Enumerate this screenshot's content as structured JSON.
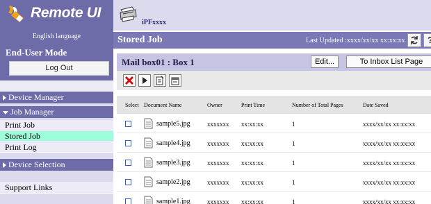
{
  "sidebar": {
    "logo_text": "Remote UI",
    "language": "English language",
    "mode_title": "End-User Mode",
    "logout_label": "Log Out",
    "device_manager": "Device Manager",
    "job_manager": "Job Manager",
    "job_items": [
      "Print Job",
      "Stored Job",
      "Print Log"
    ],
    "device_selection": "Device Selection",
    "support_links": "Support Links",
    "colors": {
      "header": "#6d6ba8",
      "active_item": "#9dfcda"
    }
  },
  "header": {
    "printer_name": "iPFxxxx",
    "page_title": "Stored Job",
    "last_updated": "Last Updated :xxxx/xx/xx xx:xx:xx",
    "help_label": "?"
  },
  "mailbox": {
    "title": "Mail box01 : Box 1",
    "edit_label": "Edit...",
    "inbox_label": "To Inbox List Page",
    "toolbar_icons": [
      "delete-icon",
      "print-play-icon",
      "document-edit-icon",
      "document-move-icon"
    ]
  },
  "table": {
    "columns": [
      "Select",
      "Document Name",
      "Owner",
      "Print Time",
      "Number of Total Pages",
      "Date Saved"
    ],
    "rows": [
      {
        "name": "sample5.jpg",
        "owner": "xxxxxxx",
        "time": "xx:xx:xx",
        "pages": "1",
        "date": "xxxx/xx/xx xx:xx:xx"
      },
      {
        "name": "sample4.jpg",
        "owner": "xxxxxxx",
        "time": "xx:xx:xx",
        "pages": "1",
        "date": "xxxx/xx/xx xx:xx:xx"
      },
      {
        "name": "sample3.jpg",
        "owner": "xxxxxxx",
        "time": "xx:xx:xx",
        "pages": "1",
        "date": "xxxx/xx/xx xx:xx:xx"
      },
      {
        "name": "sample2.jpg",
        "owner": "xxxxxxx",
        "time": "xx:xx:xx",
        "pages": "1",
        "date": "xxxx/xx/xx xx:xx:xx"
      },
      {
        "name": "sample1.jpg",
        "owner": "xxxxxxx",
        "time": "xx:xx:xx",
        "pages": "1",
        "date": "xxxx/xx/xx xx:xx:xx"
      }
    ]
  }
}
